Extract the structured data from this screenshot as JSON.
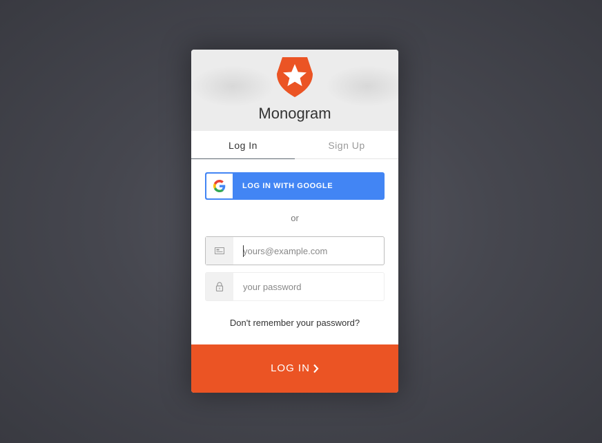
{
  "app": {
    "title": "Monogram",
    "brand_color": "#eb5424"
  },
  "tabs": [
    {
      "label": "Log In",
      "active": true
    },
    {
      "label": "Sign Up",
      "active": false
    }
  ],
  "social": {
    "google_label": "LOG IN WITH GOOGLE",
    "google_color": "#4285f4",
    "icon": "google-icon"
  },
  "separator": "or",
  "fields": {
    "email": {
      "placeholder": "yours@example.com",
      "value": "",
      "icon": "envelope-icon"
    },
    "password": {
      "placeholder": "your password",
      "value": "",
      "icon": "lock-icon"
    }
  },
  "forgot_link": "Don't remember your password?",
  "submit": {
    "label": "LOG IN",
    "icon": "chevron-right-icon"
  }
}
